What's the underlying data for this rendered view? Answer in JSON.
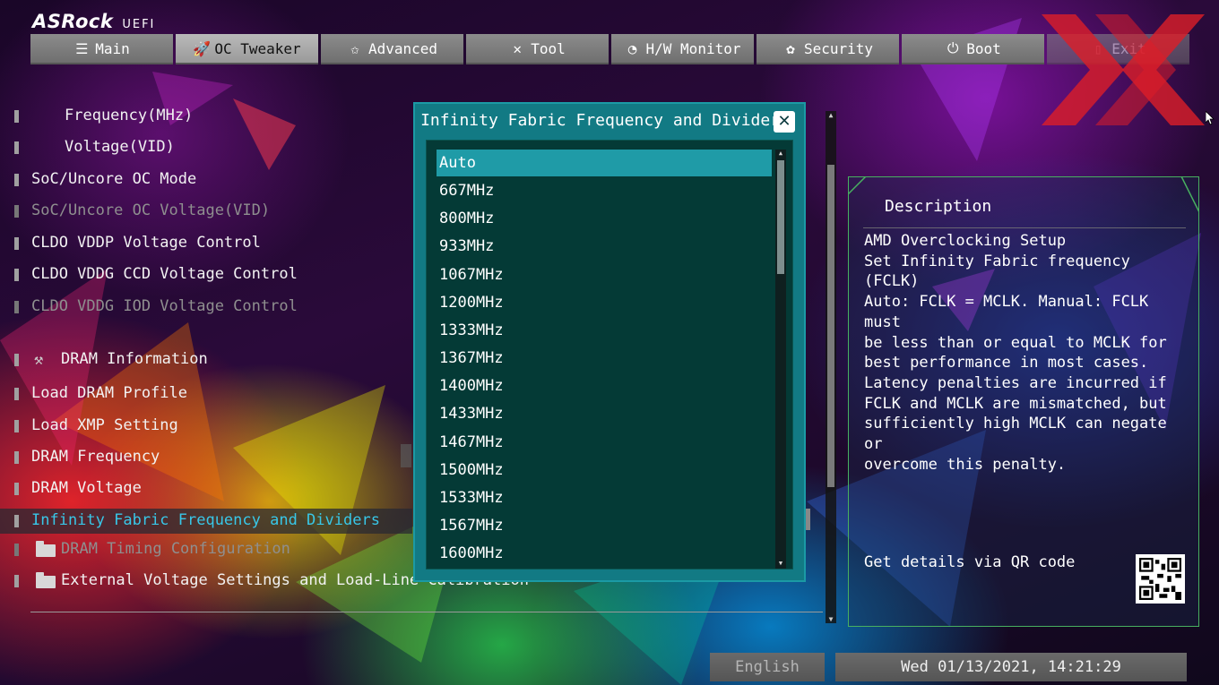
{
  "header": {
    "brand": "ASRock",
    "subtitle": "UEFI"
  },
  "nav": {
    "tabs": [
      {
        "label": "Main",
        "icon": "list-icon",
        "glyph": "☰",
        "active": false
      },
      {
        "label": "OC Tweaker",
        "icon": "rocket-icon",
        "glyph": "🚀",
        "active": true
      },
      {
        "label": "Advanced",
        "icon": "star-icon",
        "glyph": "✩",
        "active": false
      },
      {
        "label": "Tool",
        "icon": "tools-icon",
        "glyph": "✕",
        "active": false
      },
      {
        "label": "H/W Monitor",
        "icon": "monitor-icon",
        "glyph": "◔",
        "active": false
      },
      {
        "label": "Security",
        "icon": "shield-icon",
        "glyph": "✿",
        "active": false
      },
      {
        "label": "Boot",
        "icon": "power-icon",
        "glyph": "⏻",
        "active": false
      },
      {
        "label": "Exit",
        "icon": "exit-icon",
        "glyph": "▯",
        "active": false
      }
    ]
  },
  "menu": {
    "items": [
      {
        "label": "Frequency(MHz)",
        "kind": "indent"
      },
      {
        "label": "Voltage(VID)",
        "kind": "indent"
      },
      {
        "label": "SoC/Uncore OC Mode"
      },
      {
        "label": "SoC/Uncore OC Voltage(VID)",
        "dim": true
      },
      {
        "label": "CLDO VDDP Voltage Control"
      },
      {
        "label": "CLDO VDDG CCD Voltage Control"
      },
      {
        "label": "CLDO VDDG IOD Voltage Control",
        "dim": true
      },
      {
        "label": "DRAM Information",
        "kind": "tool"
      },
      {
        "label": "Load DRAM Profile"
      },
      {
        "label": "Load XMP Setting"
      },
      {
        "label": "DRAM Frequency"
      },
      {
        "label": "DRAM Voltage"
      },
      {
        "label": "Infinity Fabric Frequency and Dividers",
        "selected": true
      },
      {
        "label": "DRAM Timing Configuration",
        "kind": "folder",
        "dim": true
      },
      {
        "label": "External Voltage Settings and Load-Line Calibration",
        "kind": "folder"
      }
    ]
  },
  "popup": {
    "title": "Infinity Fabric Frequency and Dividers",
    "close_glyph": "✕",
    "options": [
      "Auto",
      "667MHz",
      "800MHz",
      "933MHz",
      "1067MHz",
      "1200MHz",
      "1333MHz",
      "1367MHz",
      "1400MHz",
      "1433MHz",
      "1467MHz",
      "1500MHz",
      "1533MHz",
      "1567MHz",
      "1600MHz"
    ],
    "selected_index": 0
  },
  "description": {
    "title": "Description",
    "text": "AMD Overclocking Setup\nSet Infinity Fabric frequency (FCLK)\nAuto: FCLK = MCLK. Manual: FCLK must\nbe less than or equal to MCLK for\nbest performance in most cases.\nLatency penalties are incurred if\nFCLK and MCLK are mismatched, but\nsufficiently high MCLK can negate or\novercome this penalty.",
    "qr_label": "Get details via QR code"
  },
  "footer": {
    "language": "English",
    "datetime": "Wed 01/13/2021, 14:21:29"
  },
  "scroll_glyphs": {
    "up": "▲",
    "down": "▼"
  },
  "colors": {
    "accent": "#38c7e8",
    "popup_bg": "#127a84",
    "list_bg": "#043a36",
    "selected_option": "#1f9ba7",
    "panel_border": "#48b060"
  }
}
